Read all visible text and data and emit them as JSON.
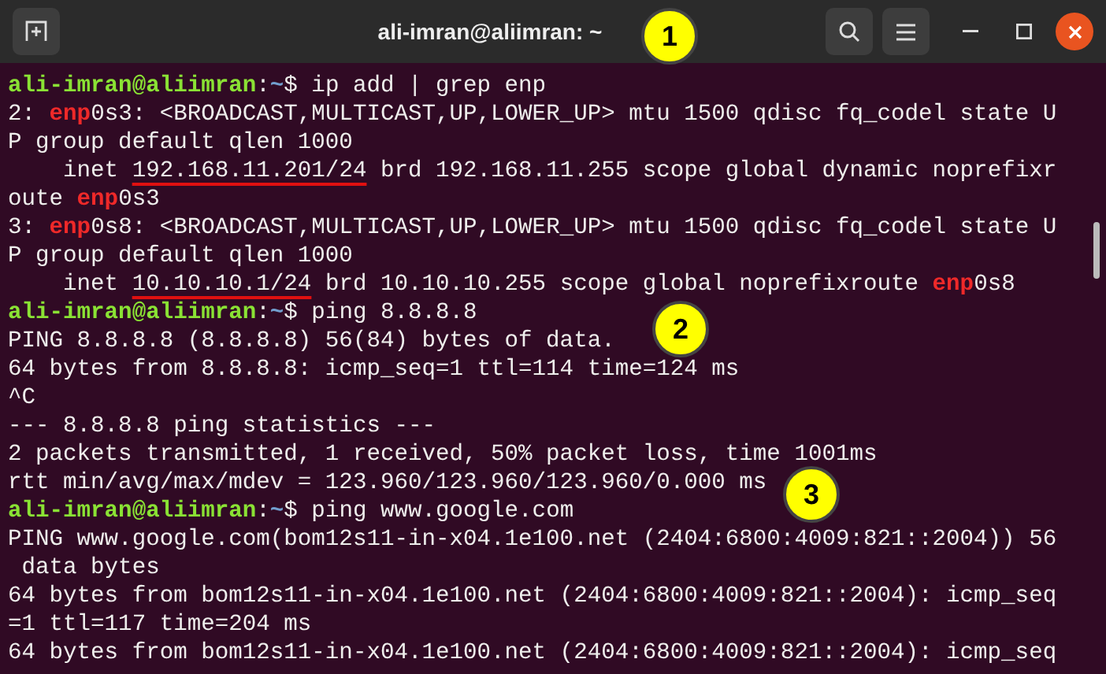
{
  "window": {
    "title": "ali-imran@aliimran: ~"
  },
  "terminal": {
    "lines": [
      [
        {
          "kind": "user",
          "text": "ali-imran@aliimran"
        },
        {
          "kind": "text",
          "text": ":"
        },
        {
          "kind": "path",
          "text": "~"
        },
        {
          "kind": "text",
          "text": "$ ip add | grep enp"
        }
      ],
      [
        {
          "kind": "text",
          "text": "2: "
        },
        {
          "kind": "match",
          "text": "enp"
        },
        {
          "kind": "text",
          "text": "0s3: <BROADCAST,MULTICAST,UP,LOWER_UP> mtu 1500 qdisc fq_codel state U"
        }
      ],
      [
        {
          "kind": "text",
          "text": "P group default qlen 1000"
        }
      ],
      [
        {
          "kind": "text",
          "text": "    inet "
        },
        {
          "kind": "underlined",
          "text": "192.168.11.201/24"
        },
        {
          "kind": "text",
          "text": " brd 192.168.11.255 scope global dynamic noprefixr"
        }
      ],
      [
        {
          "kind": "text",
          "text": "oute "
        },
        {
          "kind": "match",
          "text": "enp"
        },
        {
          "kind": "text",
          "text": "0s3"
        }
      ],
      [
        {
          "kind": "text",
          "text": "3: "
        },
        {
          "kind": "match",
          "text": "enp"
        },
        {
          "kind": "text",
          "text": "0s8: <BROADCAST,MULTICAST,UP,LOWER_UP> mtu 1500 qdisc fq_codel state U"
        }
      ],
      [
        {
          "kind": "text",
          "text": "P group default qlen 1000"
        }
      ],
      [
        {
          "kind": "text",
          "text": "    inet "
        },
        {
          "kind": "underlined",
          "text": "10.10.10.1/24"
        },
        {
          "kind": "text",
          "text": " brd 10.10.10.255 scope global noprefixroute "
        },
        {
          "kind": "match",
          "text": "enp"
        },
        {
          "kind": "text",
          "text": "0s8"
        }
      ],
      [
        {
          "kind": "user",
          "text": "ali-imran@aliimran"
        },
        {
          "kind": "text",
          "text": ":"
        },
        {
          "kind": "path",
          "text": "~"
        },
        {
          "kind": "text",
          "text": "$ ping 8.8.8.8"
        }
      ],
      [
        {
          "kind": "text",
          "text": "PING 8.8.8.8 (8.8.8.8) 56(84) bytes of data."
        }
      ],
      [
        {
          "kind": "text",
          "text": "64 bytes from 8.8.8.8: icmp_seq=1 ttl=114 time=124 ms"
        }
      ],
      [
        {
          "kind": "text",
          "text": "^C"
        }
      ],
      [
        {
          "kind": "text",
          "text": "--- 8.8.8.8 ping statistics ---"
        }
      ],
      [
        {
          "kind": "text",
          "text": "2 packets transmitted, 1 received, 50% packet loss, time 1001ms"
        }
      ],
      [
        {
          "kind": "text",
          "text": "rtt min/avg/max/mdev = 123.960/123.960/123.960/0.000 ms"
        }
      ],
      [
        {
          "kind": "user",
          "text": "ali-imran@aliimran"
        },
        {
          "kind": "text",
          "text": ":"
        },
        {
          "kind": "path",
          "text": "~"
        },
        {
          "kind": "text",
          "text": "$ ping www.google.com"
        }
      ],
      [
        {
          "kind": "text",
          "text": "PING www.google.com(bom12s11-in-x04.1e100.net (2404:6800:4009:821::2004)) 56"
        }
      ],
      [
        {
          "kind": "text",
          "text": " data bytes"
        }
      ],
      [
        {
          "kind": "text",
          "text": "64 bytes from bom12s11-in-x04.1e100.net (2404:6800:4009:821::2004): icmp_seq"
        }
      ],
      [
        {
          "kind": "text",
          "text": "=1 ttl=117 time=204 ms"
        }
      ],
      [
        {
          "kind": "text",
          "text": "64 bytes from bom12s11-in-x04.1e100.net (2404:6800:4009:821::2004): icmp_seq"
        }
      ]
    ]
  },
  "callouts": [
    "1",
    "2",
    "3"
  ]
}
